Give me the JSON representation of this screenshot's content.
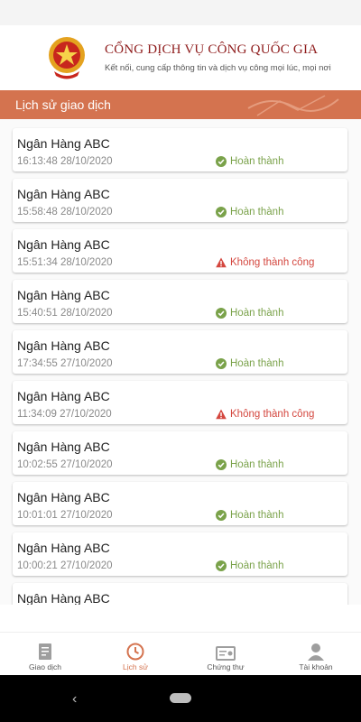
{
  "header": {
    "brand_title": "CỔNG DỊCH VỤ CÔNG QUỐC GIA",
    "brand_subtitle": "Kết nối, cung cấp thông tin và dịch vụ công mọi lúc, mọi nơi"
  },
  "section": {
    "title": "Lịch sử giao dịch"
  },
  "colors": {
    "accent": "#d4734f",
    "brand": "#8f1d1d",
    "success": "#7aa24a",
    "error": "#d4473f"
  },
  "transactions": [
    {
      "name": "Ngân Hàng ABC",
      "time": "16:13:48 28/10/2020",
      "status": "Hoàn thành",
      "state": "success"
    },
    {
      "name": "Ngân Hàng ABC",
      "time": "15:58:48 28/10/2020",
      "status": "Hoàn thành",
      "state": "success"
    },
    {
      "name": "Ngân Hàng ABC",
      "time": "15:51:34 28/10/2020",
      "status": "Không thành công",
      "state": "fail"
    },
    {
      "name": "Ngân Hàng ABC",
      "time": "15:40:51 28/10/2020",
      "status": "Hoàn thành",
      "state": "success"
    },
    {
      "name": "Ngân Hàng ABC",
      "time": "17:34:55 27/10/2020",
      "status": "Hoàn thành",
      "state": "success"
    },
    {
      "name": "Ngân Hàng ABC",
      "time": "11:34:09 27/10/2020",
      "status": "Không thành công",
      "state": "fail"
    },
    {
      "name": "Ngân Hàng ABC",
      "time": "10:02:55 27/10/2020",
      "status": "Hoàn thành",
      "state": "success"
    },
    {
      "name": "Ngân Hàng ABC",
      "time": "10:01:01 27/10/2020",
      "status": "Hoàn thành",
      "state": "success"
    },
    {
      "name": "Ngân Hàng ABC",
      "time": "10:00:21 27/10/2020",
      "status": "Hoàn thành",
      "state": "success"
    },
    {
      "name": "Ngân Hàng ABC"
    }
  ],
  "bottom_nav": [
    {
      "label": "Giao dịch",
      "icon": "document-icon",
      "active": false
    },
    {
      "label": "Lịch sử",
      "icon": "history-icon",
      "active": true
    },
    {
      "label": "Chứng thư",
      "icon": "certificate-icon",
      "active": false
    },
    {
      "label": "Tài khoản",
      "icon": "user-icon",
      "active": false
    }
  ]
}
